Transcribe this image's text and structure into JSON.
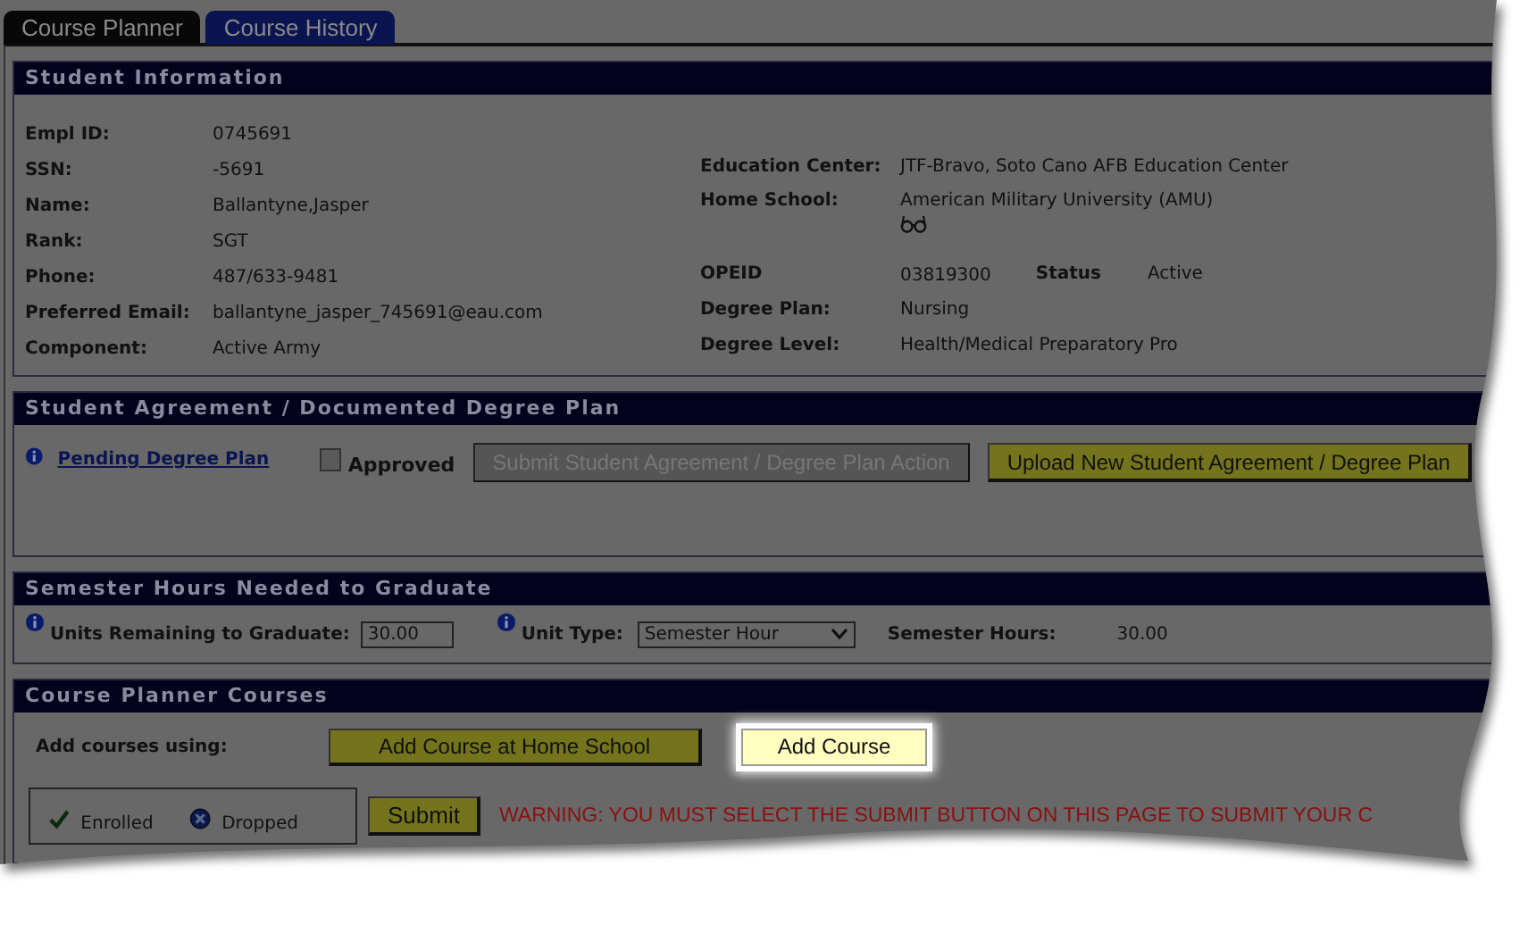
{
  "tabs": [
    {
      "label": "Course Planner",
      "selected": true
    },
    {
      "label": "Course History",
      "selected": false
    }
  ],
  "student_info": {
    "title": "Student Information",
    "left_fields": [
      {
        "label": "Empl ID:",
        "value": "0745691"
      },
      {
        "label": "SSN:",
        "value": "-5691"
      },
      {
        "label": "Name:",
        "value": "Ballantyne,Jasper"
      },
      {
        "label": "Rank:",
        "value": "SGT"
      },
      {
        "label": "Phone:",
        "value": "487/633-9481"
      },
      {
        "label": "Preferred Email:",
        "value": "ballantyne_jasper_745691@eau.com"
      },
      {
        "label": "Component:",
        "value": "Active Army"
      }
    ],
    "right_fields": [
      {
        "kind": "plain",
        "label": "Education Center:",
        "value": "JTF-Bravo, Soto Cano AFB Education Center"
      },
      {
        "kind": "with_icon",
        "label": "Home School:",
        "value": "American Military University (AMU)"
      },
      {
        "kind": "with_status",
        "label": "OPEID",
        "value": "03819300",
        "status_label": "Status",
        "status_value": "Active"
      },
      {
        "kind": "plain",
        "label": "Degree Plan:",
        "value": "Nursing"
      },
      {
        "kind": "plain",
        "label": "Degree Level:",
        "value": "Health/Medical Preparatory Pro"
      }
    ]
  },
  "agreement": {
    "title": "Student Agreement / Documented Degree Plan",
    "link": "Pending Degree Plan",
    "checkbox": {
      "label": "Approved",
      "checked": false
    },
    "buttons": [
      {
        "label": "Submit Student Agreement / Degree Plan Action",
        "disabled": true
      },
      {
        "label": "Upload New Student Agreement / Degree Plan",
        "disabled": false
      }
    ]
  },
  "semester": {
    "title": "Semester Hours Needed to Graduate",
    "units_label": "Units Remaining to Graduate:",
    "units_value": "30.00",
    "unit_type_label": "Unit Type:",
    "unit_type_value": "Semester Hour",
    "hours_label": "Semester Hours:",
    "hours_value": "30.00"
  },
  "courses": {
    "title": "Course Planner Courses",
    "add_label": "Add courses using:",
    "buttons": [
      {
        "label": "Add Course at Home School",
        "highlighted": false
      },
      {
        "label": "Add Course",
        "highlighted": true
      }
    ],
    "legend": [
      {
        "kind": "enrolled",
        "label": "Enrolled"
      },
      {
        "kind": "dropped",
        "label": "Dropped"
      }
    ],
    "submit": "Submit",
    "warning": "WARNING: YOU MUST SELECT THE SUBMIT BUTTON ON THIS PAGE TO SUBMIT YOUR C"
  }
}
